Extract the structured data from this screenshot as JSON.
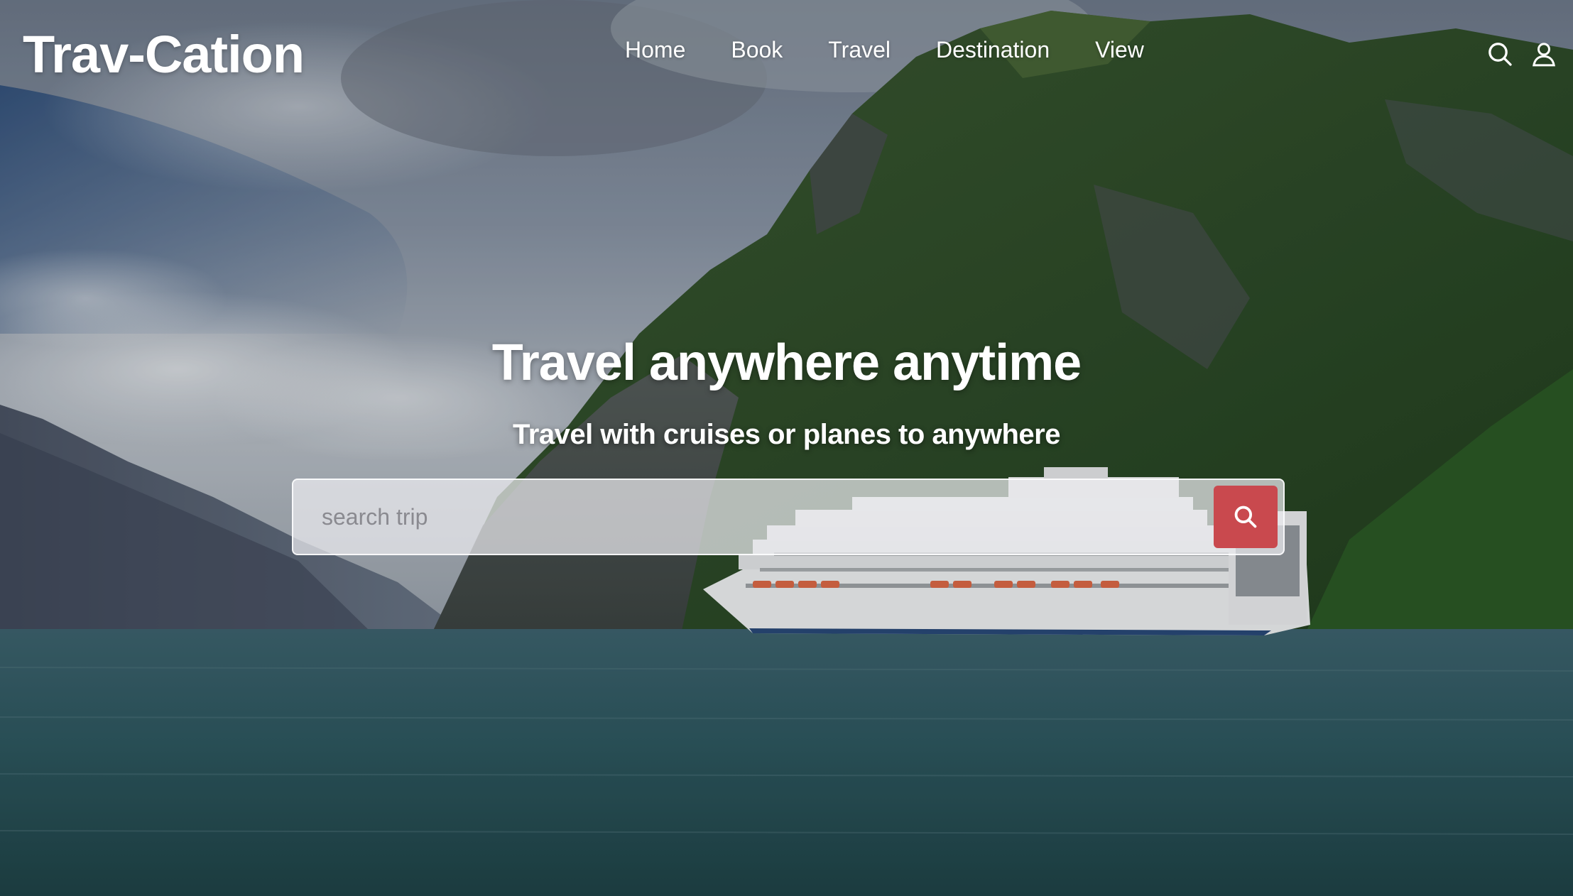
{
  "brand": {
    "logo_text": "Trav-Cation"
  },
  "nav": {
    "items": [
      {
        "label": "Home"
      },
      {
        "label": "Book"
      },
      {
        "label": "Travel"
      },
      {
        "label": "Destination"
      },
      {
        "label": "View"
      }
    ]
  },
  "header_icons": [
    "search-icon",
    "user-icon"
  ],
  "hero": {
    "title": "Travel anywhere anytime",
    "subtitle": "Travel with cruises or planes to anywhere"
  },
  "search": {
    "placeholder": "search trip",
    "value": "",
    "button_icon": "search-icon"
  },
  "colors": {
    "accent": "#c9494e",
    "text": "#ffffff"
  }
}
